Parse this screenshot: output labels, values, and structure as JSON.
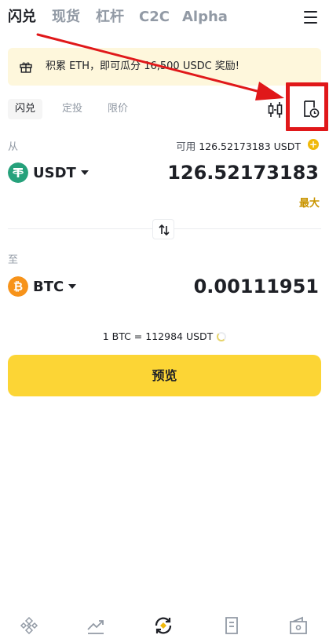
{
  "top_tabs": [
    "闪兑",
    "现货",
    "杠杆",
    "C2C",
    "Alpha"
  ],
  "banner": {
    "text": "积累 ETH，即可瓜分 16,500 USDC 奖励!"
  },
  "modes": [
    "闪兑",
    "定投",
    "限价"
  ],
  "from": {
    "label": "从",
    "available_label": "可用",
    "available_value": "126.52173183 USDT",
    "coin": "USDT",
    "amount": "126.52173183",
    "max_label": "最大"
  },
  "to": {
    "label": "至",
    "coin": "BTC",
    "amount": "0.00111951"
  },
  "rate": "1 BTC = 112984 USDT",
  "preview_label": "预览",
  "colors": {
    "accent": "#fcd535",
    "highlight_frame": "#e0181a",
    "arrow": "#e0181a",
    "usdt": "#26a17b",
    "btc": "#f7931a"
  },
  "icons": {
    "menu": "hamburger-menu-icon",
    "chart": "candlestick-chart-icon",
    "history": "order-history-icon",
    "swap": "swap-arrows-icon",
    "bottom_nav": [
      "home-icon",
      "markets-icon",
      "trade-icon",
      "futures-icon",
      "wallet-icon"
    ]
  }
}
